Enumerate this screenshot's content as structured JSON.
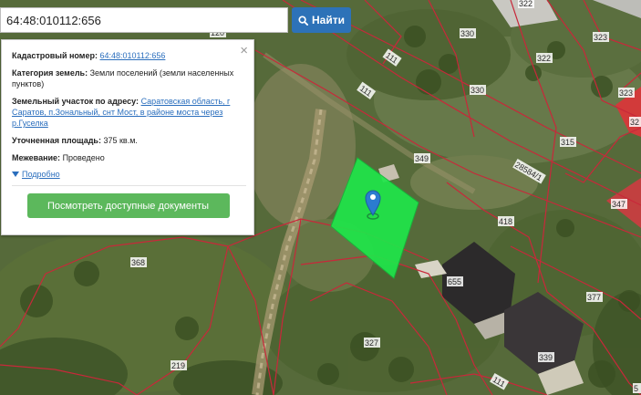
{
  "search": {
    "value": "64:48:010112:656",
    "button_label": "Найти"
  },
  "info_panel": {
    "cadastral_label": "Кадастровый номер:",
    "cadastral_value": "64:48:010112:656",
    "category_label": "Категория земель:",
    "category_value": "Земли поселений (земли населенных пунктов)",
    "address_label": "Земельный участок по адресу:",
    "address_value": "Саратовская область, г Саратов, п.Зональный, снт Мост, в районе моста через р.Гуселка",
    "area_label": "Уточненная площадь:",
    "area_value": "375 кв.м.",
    "survey_label": "Межевание:",
    "survey_value": "Проведено",
    "details_link": "Подробно",
    "docs_button": "Посмотреть доступные документы",
    "close_symbol": "×"
  },
  "map": {
    "plot_labels": [
      "120",
      "322",
      "330",
      "323",
      "111",
      "322",
      "330",
      "111",
      "323",
      "32",
      "349",
      "315",
      "28584/1",
      "347",
      "418",
      "368",
      "655",
      "377",
      "327",
      "219",
      "339",
      "111",
      "5"
    ]
  },
  "colors": {
    "boundary": "#c8283a",
    "selected_plot": "#1fe64a",
    "search_button": "#2d72b8",
    "docs_button": "#5cb85c",
    "link": "#2a6ebd",
    "marker": "#2b7cd0"
  },
  "icons": [
    "search-icon",
    "close-icon",
    "chevron-down-icon",
    "map-marker-icon"
  ]
}
